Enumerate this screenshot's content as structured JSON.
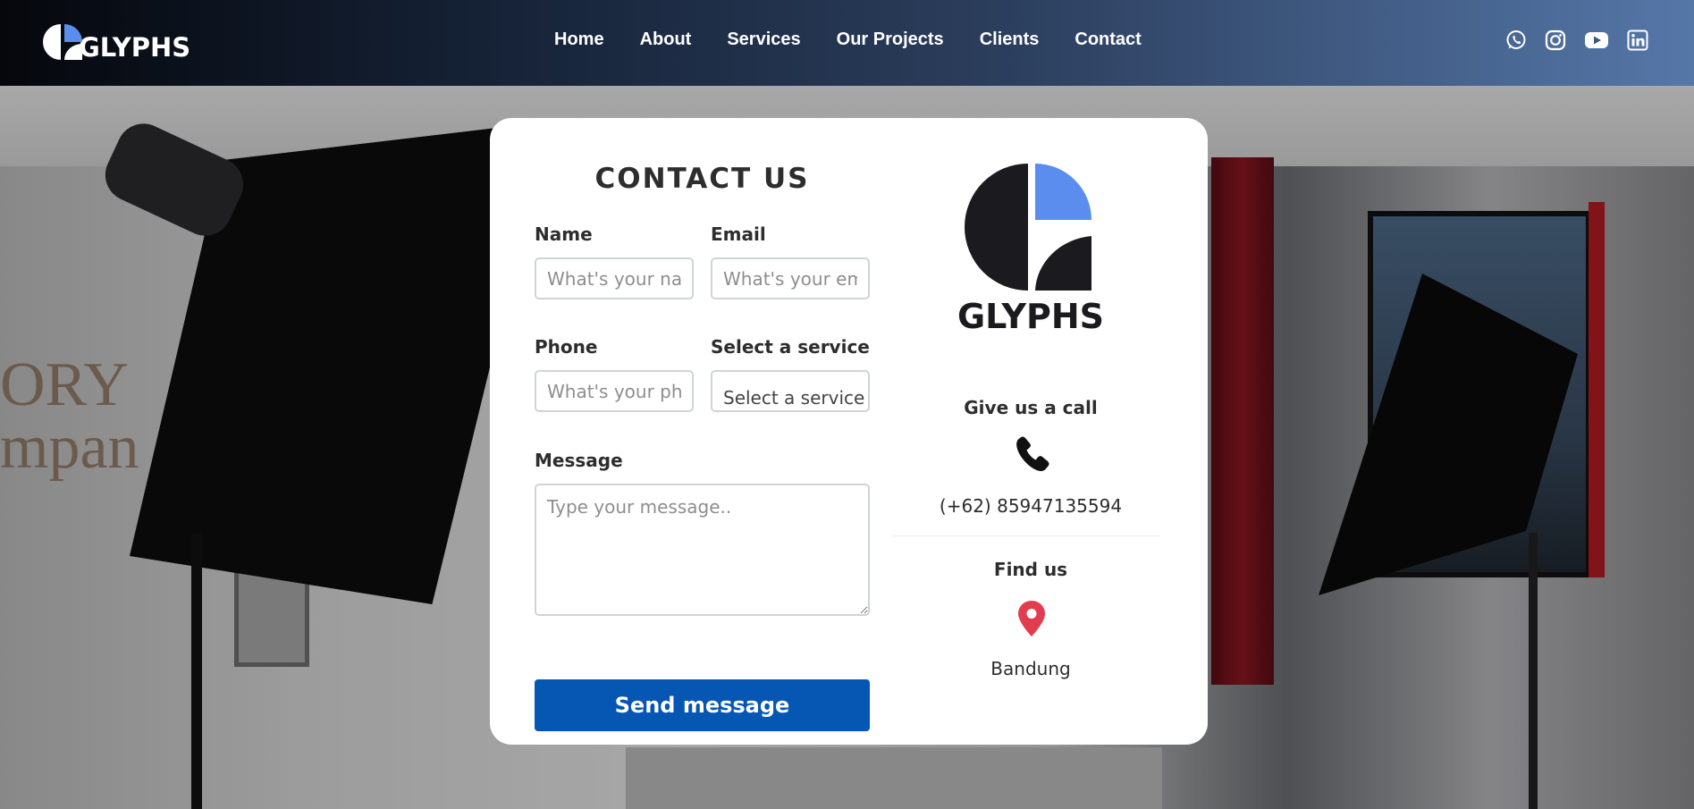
{
  "header": {
    "brand": "GLYPHS",
    "nav": [
      "Home",
      "About",
      "Services",
      "Our Projects",
      "Clients",
      "Contact"
    ],
    "socials": [
      "whatsapp-icon",
      "instagram-icon",
      "youtube-icon",
      "linkedin-icon"
    ]
  },
  "background": {
    "wall_text": [
      "ORY",
      "mpan"
    ]
  },
  "contact": {
    "title": "CONTACT US",
    "name_label": "Name",
    "name_placeholder": "What's your name",
    "email_label": "Email",
    "email_placeholder": "What's your email",
    "phone_label": "Phone",
    "phone_placeholder": "What's your phone",
    "service_label": "Select a service",
    "service_value": "Select a service",
    "message_label": "Message",
    "message_placeholder": "Type your message..",
    "submit": "Send message"
  },
  "info": {
    "brand": "GLYPHS",
    "call_title": "Give us a call",
    "phone": "(+62) 85947135594",
    "find_title": "Find us",
    "location": "Bandung"
  },
  "colors": {
    "accent": "#5b8def",
    "button": "#0656b4",
    "pin": "#e23d4e",
    "dark": "#1b1b1f"
  }
}
